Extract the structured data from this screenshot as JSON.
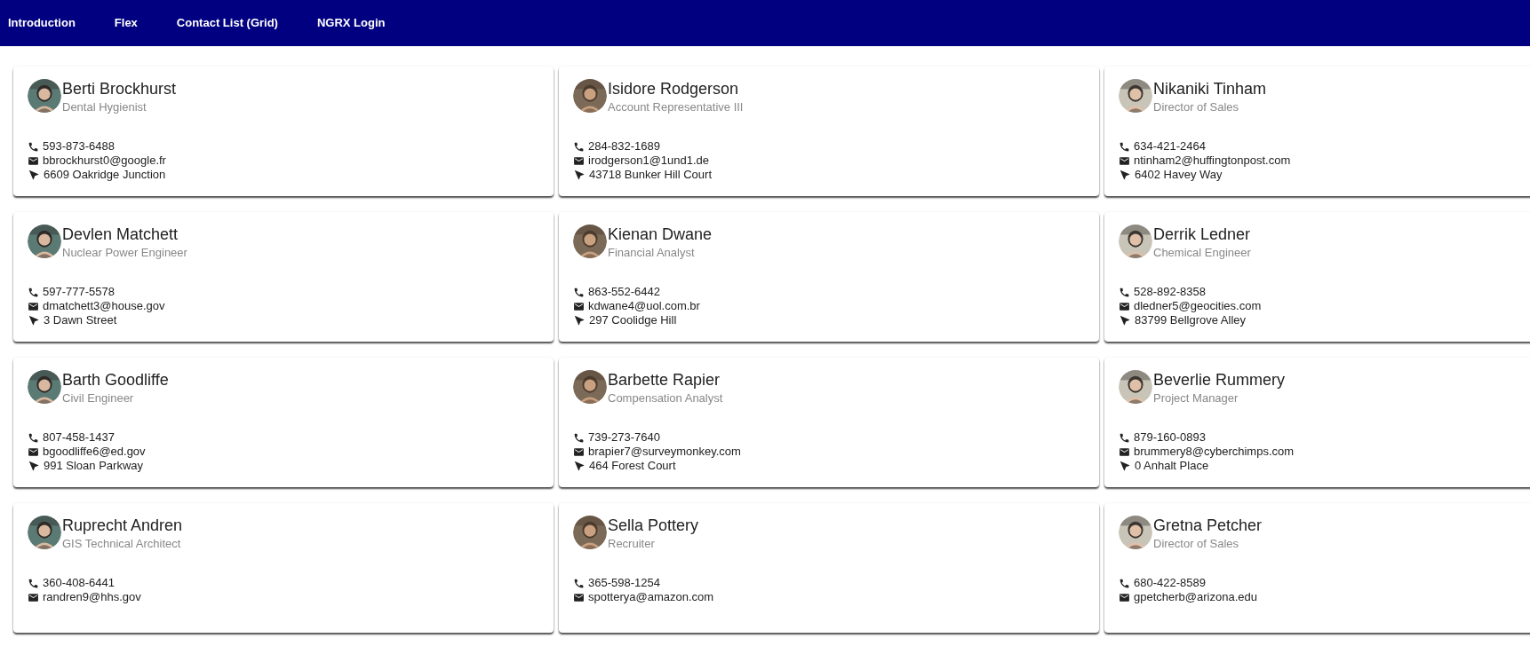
{
  "nav": {
    "links": [
      "Introduction",
      "Flex",
      "Contact List (Grid)",
      "NGRX Login"
    ]
  },
  "contacts": [
    {
      "name": "Berti Brockhurst",
      "title": "Dental Hygienist",
      "phone": "593-873-6488",
      "email": "bbrockhurst0@google.fr",
      "address": "6609 Oakridge Junction"
    },
    {
      "name": "Isidore Rodgerson",
      "title": "Account Representative III",
      "phone": "284-832-1689",
      "email": "irodgerson1@1und1.de",
      "address": "43718 Bunker Hill Court"
    },
    {
      "name": "Nikaniki Tinham",
      "title": "Director of Sales",
      "phone": "634-421-2464",
      "email": "ntinham2@huffingtonpost.com",
      "address": "6402 Havey Way"
    },
    {
      "name": "Devlen Matchett",
      "title": "Nuclear Power Engineer",
      "phone": "597-777-5578",
      "email": "dmatchett3@house.gov",
      "address": "3 Dawn Street"
    },
    {
      "name": "Kienan Dwane",
      "title": "Financial Analyst",
      "phone": "863-552-6442",
      "email": "kdwane4@uol.com.br",
      "address": "297 Coolidge Hill"
    },
    {
      "name": "Derrik Ledner",
      "title": "Chemical Engineer",
      "phone": "528-892-8358",
      "email": "dledner5@geocities.com",
      "address": "83799 Bellgrove Alley"
    },
    {
      "name": "Barth Goodliffe",
      "title": "Civil Engineer",
      "phone": "807-458-1437",
      "email": "bgoodliffe6@ed.gov",
      "address": "991 Sloan Parkway"
    },
    {
      "name": "Barbette Rapier",
      "title": "Compensation Analyst",
      "phone": "739-273-7640",
      "email": "brapier7@surveymonkey.com",
      "address": "464 Forest Court"
    },
    {
      "name": "Beverlie Rummery",
      "title": "Project Manager",
      "phone": "879-160-0893",
      "email": "brummery8@cyberchimps.com",
      "address": "0 Anhalt Place"
    },
    {
      "name": "Ruprecht Andren",
      "title": "GIS Technical Architect",
      "phone": "360-408-6441",
      "email": "randren9@hhs.gov"
    },
    {
      "name": "Sella Pottery",
      "title": "Recruiter",
      "phone": "365-598-1254",
      "email": "spotterya@amazon.com"
    },
    {
      "name": "Gretna Petcher",
      "title": "Director of Sales",
      "phone": "680-422-8589",
      "email": "gpetcherb@arizona.edu"
    }
  ]
}
